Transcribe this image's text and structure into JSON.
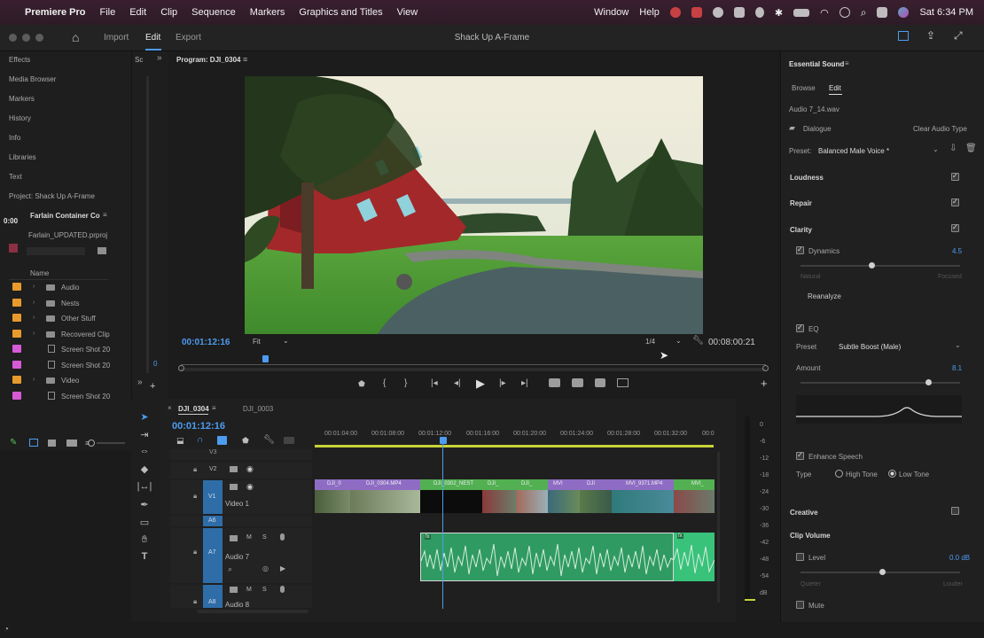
{
  "menubar": {
    "app_name": "Premiere Pro",
    "items": [
      "File",
      "Edit",
      "Clip",
      "Sequence",
      "Markers",
      "Graphics and Titles",
      "View"
    ],
    "right_items": [
      "Window",
      "Help"
    ],
    "clock": "Sat 6:34 PM"
  },
  "header": {
    "workspaces": [
      "Import",
      "Edit",
      "Export"
    ],
    "active_workspace": "Edit",
    "project_title": "Shack Up A-Frame"
  },
  "left_panel": {
    "panels": [
      "Effects",
      "Media Browser",
      "Markers",
      "History",
      "Info",
      "Libraries",
      "Text",
      "Project: Shack Up A-Frame"
    ],
    "bin_tab": "Farlain Container Co",
    "bin_time": "0:00",
    "project_file": "Farlain_UPDATED.prproj",
    "column_name": "Name",
    "items": [
      {
        "label": "Audio",
        "color": "#e89a2c",
        "type": "bin"
      },
      {
        "label": "Nests",
        "color": "#e89a2c",
        "type": "bin"
      },
      {
        "label": "Other Stuff",
        "color": "#e89a2c",
        "type": "bin"
      },
      {
        "label": "Recovered Clip",
        "color": "#e89a2c",
        "type": "bin"
      },
      {
        "label": "Screen Shot 20",
        "color": "#d65ad6",
        "type": "clip"
      },
      {
        "label": "Screen Shot 20",
        "color": "#d65ad6",
        "type": "clip"
      },
      {
        "label": "Video",
        "color": "#e89a2c",
        "type": "bin"
      },
      {
        "label": "Screen Shot 20",
        "color": "#d65ad6",
        "type": "clip"
      }
    ]
  },
  "midstrip": {
    "tab": "Sc",
    "value": "0"
  },
  "program": {
    "title": "Program: DJI_0304",
    "timecode_current": "00:01:12:16",
    "fit": "Fit",
    "resolution": "1/4",
    "timecode_duration": "00:08:00:21"
  },
  "timeline": {
    "tabs": [
      "DJI_0304",
      "DJI_0003"
    ],
    "timecode": "00:01:12:16",
    "ruler_labels": [
      "00:01:04:00",
      "00:01:08:00",
      "00:01:12:00",
      "00:01:16:00",
      "00:01:20:00",
      "00:01:24:00",
      "00:01:28:00",
      "00:01:32:00",
      "00:0"
    ],
    "tracks": [
      {
        "id": "V3",
        "name": ""
      },
      {
        "id": "V2",
        "name": ""
      },
      {
        "id": "V1",
        "name": "Video 1"
      },
      {
        "id": "A6",
        "name": ""
      },
      {
        "id": "A7",
        "name": "Audio 7"
      },
      {
        "id": "A8",
        "name": "Audio 8"
      }
    ],
    "video_clips": [
      "DJI_0",
      "DJI_0304.MP4",
      "DJI_0302_NEST",
      "DJI_",
      "DJI_",
      "MVI",
      "DJI",
      "MVI_9371.MP4",
      "MVI_"
    ],
    "audio_clips": [
      "fx",
      "fx"
    ]
  },
  "meters": {
    "scale": [
      "0",
      "-6",
      "-12",
      "-18",
      "-24",
      "-30",
      "-36",
      "-42",
      "-48",
      "-54",
      "dB"
    ]
  },
  "essential_sound": {
    "title": "Essential Sound",
    "tabs": [
      "Browse",
      "Edit"
    ],
    "active_tab": "Edit",
    "file": "Audio 7_14.wav",
    "type_label": "Dialogue",
    "clear_label": "Clear Audio Type",
    "preset_label": "Preset:",
    "preset_value": "Balanced Male Voice *",
    "sections": {
      "loudness": "Loudness",
      "repair": "Repair",
      "clarity": "Clarity",
      "creative": "Creative",
      "clip_volume": "Clip Volume"
    },
    "dynamics": {
      "label": "Dynamics",
      "value": "4.5",
      "min": "Natural",
      "max": "Focused",
      "fraction": 0.6
    },
    "reanalyze": "Reanalyze",
    "eq": {
      "label": "EQ",
      "preset_label": "Preset",
      "preset": "Subtle Boost (Male)",
      "amount_label": "Amount",
      "amount": "8.1",
      "fraction": 0.81
    },
    "enhance_speech": {
      "label": "Enhance Speech",
      "type_label": "Type",
      "options": [
        "High Tone",
        "Low Tone"
      ],
      "selected": "Low Tone"
    },
    "level": {
      "label": "Level",
      "value": "0.0 dB",
      "min": "Quieter",
      "max": "Louder",
      "fraction": 0.5
    },
    "mute": "Mute"
  }
}
